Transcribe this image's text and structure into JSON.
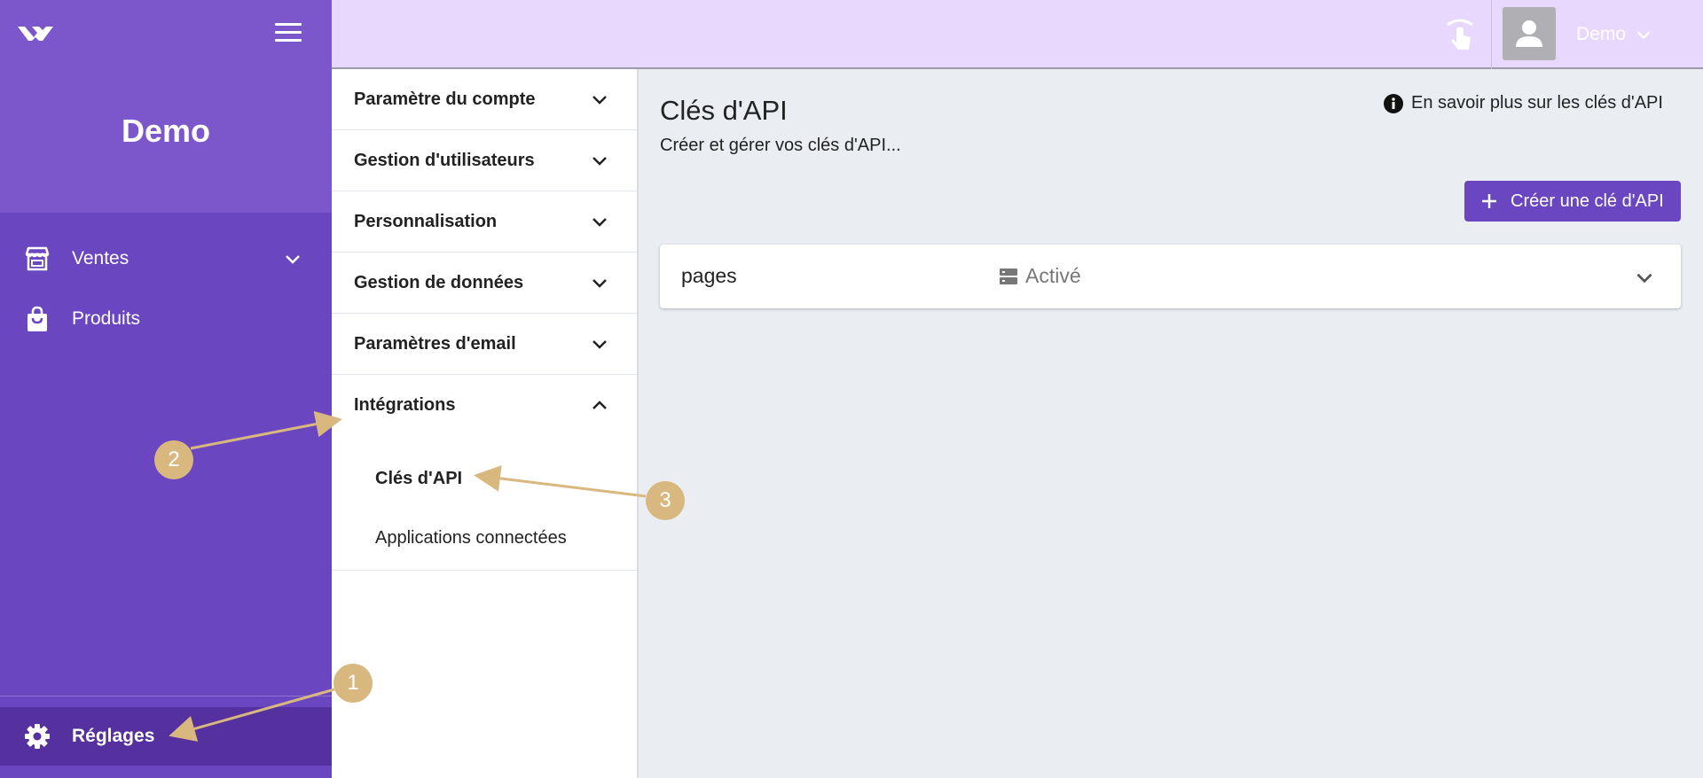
{
  "sidebar": {
    "brand": "Demo",
    "items": [
      {
        "label": "Ventes",
        "icon": "store-icon",
        "has_dropdown": true
      },
      {
        "label": "Produits",
        "icon": "shopping-bag-icon",
        "has_dropdown": false
      }
    ],
    "settings_label": "Réglages"
  },
  "topbar": {
    "user_name": "Demo"
  },
  "settings_menu": {
    "sections": [
      {
        "label": "Paramètre du compte",
        "expanded": false
      },
      {
        "label": "Gestion d'utilisateurs",
        "expanded": false
      },
      {
        "label": "Personnalisation",
        "expanded": false
      },
      {
        "label": "Gestion de données",
        "expanded": false
      },
      {
        "label": "Paramètres d'email",
        "expanded": false
      },
      {
        "label": "Intégrations",
        "expanded": true
      }
    ],
    "integrations_items": [
      {
        "label": "Clés d'API",
        "active": true
      },
      {
        "label": "Applications connectées",
        "active": false
      }
    ]
  },
  "main": {
    "title": "Clés d'API",
    "subtitle": "Créer et gérer vos clés d'API...",
    "learn_more": "En savoir plus sur les clés d'API",
    "create_button": "Créer une clé d'API",
    "keys": [
      {
        "name": "pages",
        "status": "Activé"
      }
    ]
  },
  "annotations": [
    "1",
    "2",
    "3"
  ],
  "colors": {
    "sidebar": "#6b46c1",
    "sidebar_top": "#7b57cb",
    "sidebar_active": "#55309f",
    "topbar": "#e8d8fd",
    "accent": "#6b46c1",
    "annotation": "#d8b87e",
    "main_bg": "#eaeef3"
  }
}
